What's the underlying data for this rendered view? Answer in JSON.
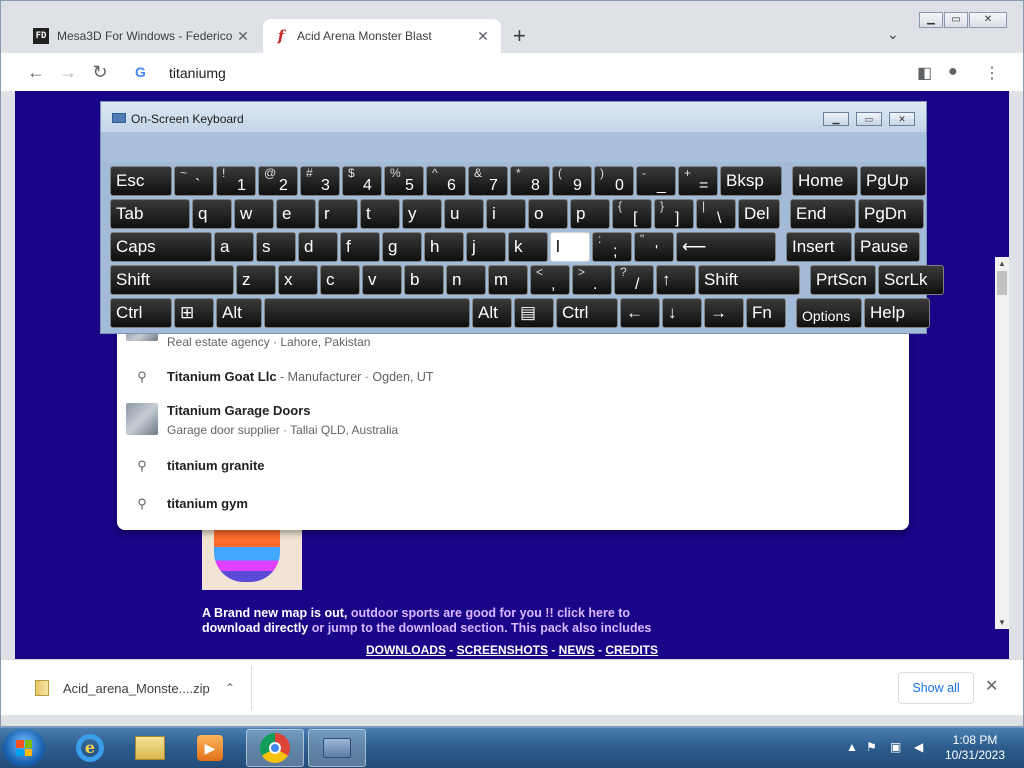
{
  "browser": {
    "tabs": [
      {
        "title": "Mesa3D For Windows - Federico",
        "favicon": "FD"
      },
      {
        "title": "Acid Arena Monster Blast",
        "favicon": "f"
      }
    ],
    "omnibox_text": "titaniumg"
  },
  "suggestions": [
    {
      "main": "",
      "desc": "Real estate agency · Lahore, Pakistan",
      "kind": "place"
    },
    {
      "main": "Titanium Goat Llc",
      "desc": " - Manufacturer · Ogden, UT",
      "kind": "search-inline"
    },
    {
      "main": "Titanium Garage Doors",
      "desc": "Garage door supplier · Tallai QLD, Australia",
      "kind": "place"
    },
    {
      "main": "titanium granite",
      "desc": "",
      "kind": "search"
    },
    {
      "main": "titanium gym",
      "desc": "",
      "kind": "search"
    }
  ],
  "page": {
    "text_white": "A Brand new map is out,",
    "text_violet": " outdoor sports are good for you !! click here to",
    "text_line2a": "download directly",
    "text_line2b": " or jump to the download section. This pack also includes",
    "links": [
      "DOWNLOADS",
      "SCREENSHOTS",
      "NEWS",
      "CREDITS"
    ],
    "link_sep": " - "
  },
  "keyboard": {
    "title": "On-Screen Keyboard",
    "rows": [
      [
        {
          "l": "Esc"
        },
        {
          "s": "~",
          "m": "`"
        },
        {
          "s": "!",
          "m": "1"
        },
        {
          "s": "@",
          "m": "2"
        },
        {
          "s": "#",
          "m": "3"
        },
        {
          "s": "$",
          "m": "4"
        },
        {
          "s": "%",
          "m": "5"
        },
        {
          "s": "^",
          "m": "6"
        },
        {
          "s": "&",
          "m": "7"
        },
        {
          "s": "*",
          "m": "8"
        },
        {
          "s": "(",
          "m": "9"
        },
        {
          "s": ")",
          "m": "0"
        },
        {
          "s": "-",
          "m": "_"
        },
        {
          "s": "+",
          "m": "="
        },
        {
          "l": "Bksp"
        },
        {
          "l": "Home"
        },
        {
          "l": "PgUp"
        }
      ],
      [
        {
          "l": "Tab"
        },
        {
          "l": "q"
        },
        {
          "l": "w"
        },
        {
          "l": "e"
        },
        {
          "l": "r"
        },
        {
          "l": "t"
        },
        {
          "l": "y"
        },
        {
          "l": "u"
        },
        {
          "l": "i"
        },
        {
          "l": "o"
        },
        {
          "l": "p"
        },
        {
          "s": "{",
          "m": "["
        },
        {
          "s": "}",
          "m": "]"
        },
        {
          "s": "|",
          "m": "\\"
        },
        {
          "l": "Del"
        },
        {
          "l": "End"
        },
        {
          "l": "PgDn"
        }
      ],
      [
        {
          "l": "Caps"
        },
        {
          "l": "a"
        },
        {
          "l": "s"
        },
        {
          "l": "d"
        },
        {
          "l": "f"
        },
        {
          "l": "g"
        },
        {
          "l": "h"
        },
        {
          "l": "j"
        },
        {
          "l": "k"
        },
        {
          "l": "l"
        },
        {
          "s": ":",
          "m": ";"
        },
        {
          "s": "\"",
          "m": "'"
        },
        {
          "l": "⟵"
        },
        {
          "l": "Insert"
        },
        {
          "l": "Pause"
        }
      ],
      [
        {
          "l": "Shift"
        },
        {
          "l": "z"
        },
        {
          "l": "x"
        },
        {
          "l": "c"
        },
        {
          "l": "v"
        },
        {
          "l": "b"
        },
        {
          "l": "n"
        },
        {
          "l": "m"
        },
        {
          "s": "<",
          "m": ","
        },
        {
          "s": ">",
          "m": "."
        },
        {
          "s": "?",
          "m": "/"
        },
        {
          "l": "↑"
        },
        {
          "l": "Shift"
        },
        {
          "l": "PrtScn"
        },
        {
          "l": "ScrLk"
        }
      ],
      [
        {
          "l": "Ctrl"
        },
        {
          "l": "⊞"
        },
        {
          "l": "Alt"
        },
        {
          "l": ""
        },
        {
          "l": "Alt"
        },
        {
          "l": "▤"
        },
        {
          "l": "Ctrl"
        },
        {
          "l": "←"
        },
        {
          "l": "↓"
        },
        {
          "l": "→"
        },
        {
          "l": "Fn"
        },
        {
          "l": "Options"
        },
        {
          "l": "Help"
        }
      ]
    ],
    "pressed_key": "l"
  },
  "downloads": {
    "file": "Acid_arena_Monste....zip",
    "show_all": "Show all"
  },
  "taskbar": {
    "time": "1:08 PM",
    "date": "10/31/2023"
  },
  "colors": {
    "page_bg": "#1a0487",
    "link_violet": "#d9b8ff",
    "show_all_blue": "#1a73e8"
  }
}
